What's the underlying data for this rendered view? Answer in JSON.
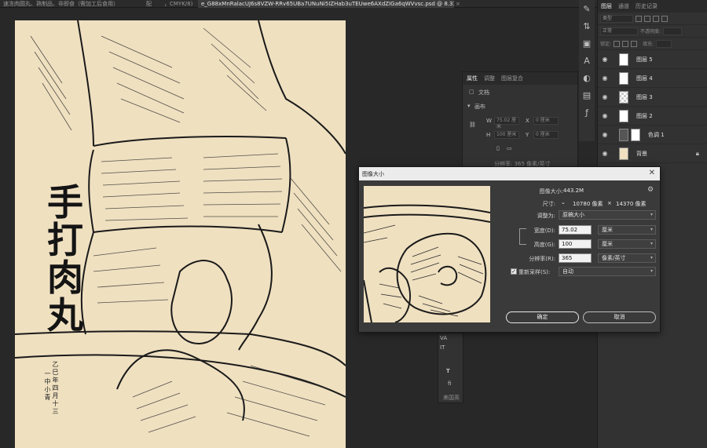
{
  "tabs": {
    "left_doc": "速冻肉圆丸、熟制品、非即食（需加工后食用）",
    "mode_doc": "配",
    "cmyk": "，CMYK/8)",
    "active_doc": "e_G88xMnRalacUJ6s8VZW-RRv65UBa7UNuNi5IZHab3uTEUwe6AXdZIGa6qWVvsc.psd @ 8.33%(RGB/8)",
    "close": "×"
  },
  "artwork": {
    "title_chars": [
      "手",
      "打",
      "肉",
      "丸"
    ],
    "date_line_1": "乙巳年四月十三",
    "date_line_2": "一中小青"
  },
  "layers_panel": {
    "tabs": [
      "图层",
      "通道",
      "历史记录"
    ],
    "kind_filter": "类型",
    "blend_mode": "正常",
    "opacity_label": "不透明度:",
    "lock_label": "锁定:",
    "fill_label": "填充:",
    "layers": [
      {
        "name": "图层 5",
        "thumb": "white"
      },
      {
        "name": "图层 4",
        "thumb": "white"
      },
      {
        "name": "图层 3",
        "thumb": "checker"
      },
      {
        "name": "图层 2",
        "thumb": "white"
      },
      {
        "name": "色调 1",
        "thumb": "adjust"
      },
      {
        "name": "背景",
        "thumb": "bg",
        "locked": true
      }
    ]
  },
  "properties_panel": {
    "tabs": [
      "属性",
      "调整",
      "图层复合"
    ],
    "doc_label": "文档",
    "section": "画布",
    "w_label": "W",
    "w_value": "75.02 厘米",
    "x_label": "X",
    "x_value": "0 厘米",
    "h_label": "H",
    "h_value": "100 厘米",
    "y_label": "Y",
    "y_value": "0 厘米",
    "resolution_text": "分辨率: 365 像素/英寸"
  },
  "char_panel": {
    "va": "VA",
    "it": "IT",
    "t": "T",
    "fi": "fi",
    "lang": "美国英"
  },
  "dialog": {
    "title": "图像大小",
    "image_size_label": "图像大小:",
    "image_size_value": "443.2M",
    "dimensions_label": "尺寸:",
    "dimensions_width": "10780 像素",
    "dimensions_x": "×",
    "dimensions_height": "14370 像素",
    "fit_to_label": "调整为:",
    "fit_to_value": "原稿大小",
    "width_label": "宽度(D):",
    "width_value": "75.02",
    "width_unit": "厘米",
    "height_label": "高度(G):",
    "height_value": "100",
    "height_unit": "厘米",
    "resolution_label": "分辨率(R):",
    "resolution_value": "365",
    "resolution_unit": "像素/英寸",
    "resample_label": "重新采样(S):",
    "resample_value": "自动",
    "ok_label": "确定",
    "cancel_label": "取消"
  }
}
